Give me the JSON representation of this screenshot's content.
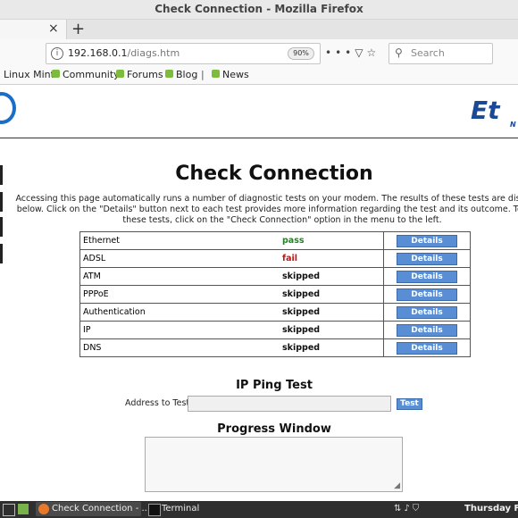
{
  "window": {
    "title": "Check Connection - Mozilla Firefox"
  },
  "tab": {
    "close_glyph": "×"
  },
  "new_tab_glyph": "+",
  "nav": {
    "url_host": "192.168.0.1",
    "url_path": "/diags.htm",
    "zoom": "90%",
    "search_placeholder": "Search"
  },
  "bookmarks": [
    "Linux Mint",
    "Community",
    "Forums",
    "Blog",
    "News"
  ],
  "bookmark_separator": "|",
  "page": {
    "title": "Check Connection",
    "description": "Accessing this page automatically runs a number of diagnostic tests on your modem. The results of these tests are displayed below. Click on the \"Details\" button next to each test provides more information regarding the test and its outcome. To rerun these tests, click on the \"Check Connection\" option in the menu to the left.",
    "details_label": "Details",
    "tests": [
      {
        "name": "Ethernet",
        "result": "pass",
        "status": "pass"
      },
      {
        "name": "ADSL",
        "result": "fail",
        "status": "fail"
      },
      {
        "name": "ATM",
        "result": "skipped",
        "status": "skipped"
      },
      {
        "name": "PPPoE",
        "result": "skipped",
        "status": "skipped"
      },
      {
        "name": "Authentication",
        "result": "skipped",
        "status": "skipped"
      },
      {
        "name": "IP",
        "result": "skipped",
        "status": "skipped"
      },
      {
        "name": "DNS",
        "result": "skipped",
        "status": "skipped"
      }
    ],
    "ping": {
      "title": "IP Ping Test",
      "address_label": "Address to Test:",
      "input_value": "",
      "test_button": "Test"
    },
    "progress": {
      "title": "Progress Window",
      "value": ""
    },
    "logo_text": "Et",
    "logo_sub": "NE"
  },
  "taskbar": {
    "tasks": [
      "Check Connection - ...",
      "Terminal"
    ],
    "clock": "Thursday Feb"
  },
  "colors": {
    "pass": "#1a8a1a",
    "fail": "#d01010",
    "button": "#5a8ed4",
    "brand": "#1a4a96"
  }
}
